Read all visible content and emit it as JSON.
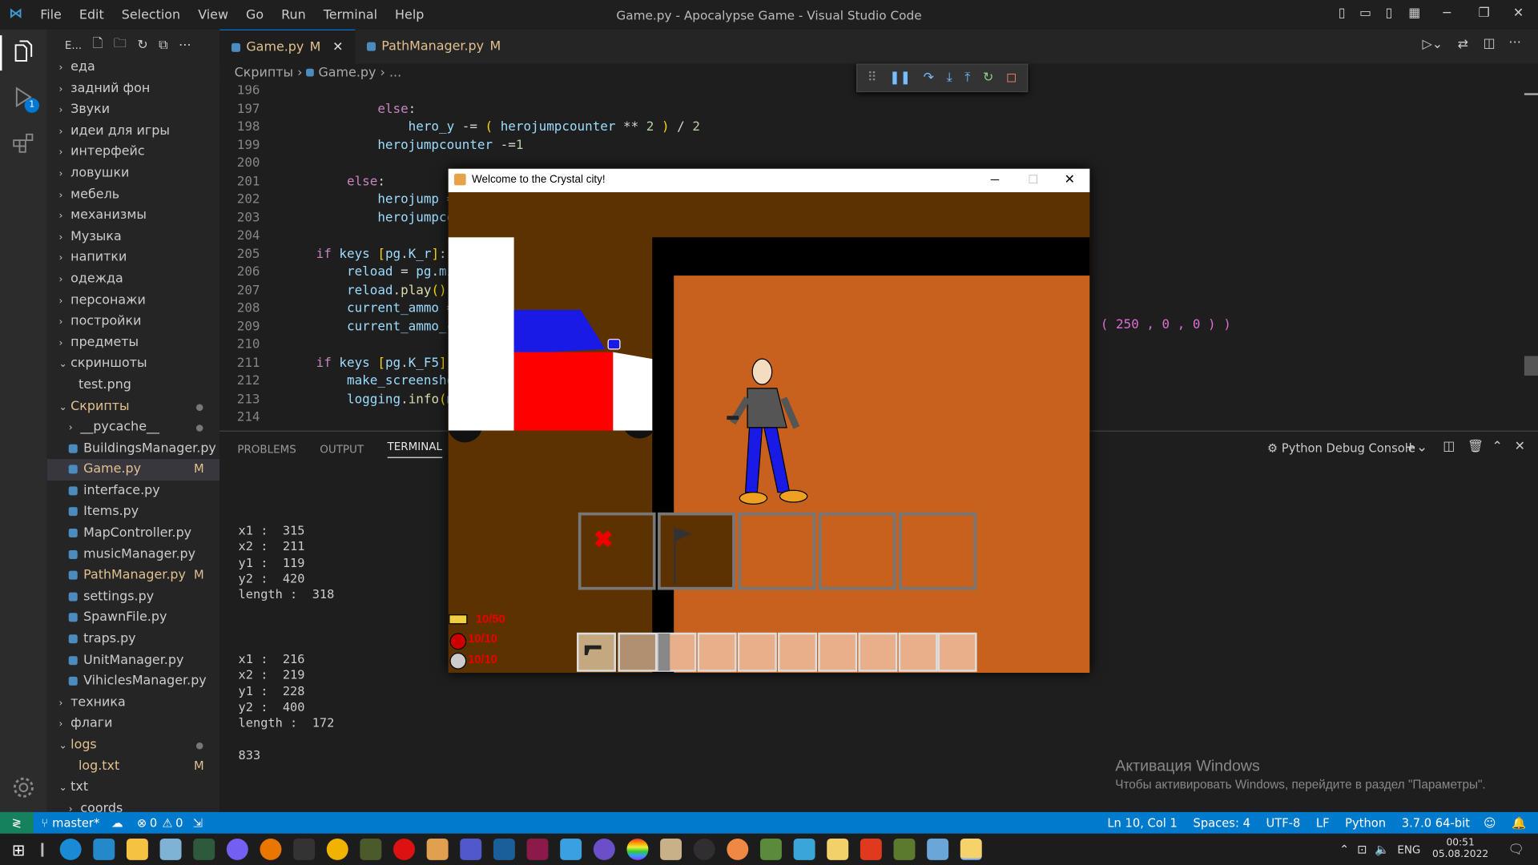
{
  "window": {
    "menu": [
      "File",
      "Edit",
      "Selection",
      "View",
      "Go",
      "Run",
      "Terminal",
      "Help"
    ],
    "title": "Game.py - Apocalypse Game - Visual Studio Code"
  },
  "activity": {
    "debug_badge": "1"
  },
  "sidebar": {
    "header_label": "E...",
    "items": [
      {
        "label": "еда",
        "type": "folder",
        "open": false,
        "indent": 0
      },
      {
        "label": "задний фон",
        "type": "folder",
        "open": false,
        "indent": 0
      },
      {
        "label": "Звуки",
        "type": "folder",
        "open": false,
        "indent": 0
      },
      {
        "label": "идеи для игры",
        "type": "folder",
        "open": false,
        "indent": 0
      },
      {
        "label": "интерфейс",
        "type": "folder",
        "open": false,
        "indent": 0
      },
      {
        "label": "ловушки",
        "type": "folder",
        "open": false,
        "indent": 0
      },
      {
        "label": "мебель",
        "type": "folder",
        "open": false,
        "indent": 0
      },
      {
        "label": "механизмы",
        "type": "folder",
        "open": false,
        "indent": 0
      },
      {
        "label": "Музыка",
        "type": "folder",
        "open": false,
        "indent": 0
      },
      {
        "label": "напитки",
        "type": "folder",
        "open": false,
        "indent": 0
      },
      {
        "label": "одежда",
        "type": "folder",
        "open": false,
        "indent": 0
      },
      {
        "label": "персонажи",
        "type": "folder",
        "open": false,
        "indent": 0
      },
      {
        "label": "постройки",
        "type": "folder",
        "open": false,
        "indent": 0
      },
      {
        "label": "предметы",
        "type": "folder",
        "open": false,
        "indent": 0
      },
      {
        "label": "скриншоты",
        "type": "folder",
        "open": true,
        "indent": 0
      },
      {
        "label": "test.png",
        "type": "file",
        "indent": 1
      },
      {
        "label": "Скрипты",
        "type": "folder",
        "open": true,
        "indent": 0,
        "dot": true,
        "color": "#e2c08d"
      },
      {
        "label": "__pycache__",
        "type": "folder",
        "open": false,
        "indent": 1,
        "dot": true
      },
      {
        "label": "BuildingsManager.py",
        "type": "py",
        "indent": 1
      },
      {
        "label": "Game.py",
        "type": "py",
        "indent": 1,
        "badge": "M",
        "selected": true,
        "color": "#e2c08d"
      },
      {
        "label": "interface.py",
        "type": "py",
        "indent": 1
      },
      {
        "label": "Items.py",
        "type": "py",
        "indent": 1
      },
      {
        "label": "MapController.py",
        "type": "py",
        "indent": 1
      },
      {
        "label": "musicManager.py",
        "type": "py",
        "indent": 1
      },
      {
        "label": "PathManager.py",
        "type": "py",
        "indent": 1,
        "badge": "M",
        "color": "#e2c08d"
      },
      {
        "label": "settings.py",
        "type": "py",
        "indent": 1
      },
      {
        "label": "SpawnFile.py",
        "type": "py",
        "indent": 1
      },
      {
        "label": "traps.py",
        "type": "py",
        "indent": 1
      },
      {
        "label": "UnitManager.py",
        "type": "py",
        "indent": 1
      },
      {
        "label": "VihiclesManager.py",
        "type": "py",
        "indent": 1
      },
      {
        "label": "техника",
        "type": "folder",
        "open": false,
        "indent": 0
      },
      {
        "label": "флаги",
        "type": "folder",
        "open": false,
        "indent": 0
      },
      {
        "label": "logs",
        "type": "folder",
        "open": true,
        "indent": 0,
        "dot": true,
        "color": "#e2c08d"
      },
      {
        "label": "log.txt",
        "type": "file",
        "indent": 1,
        "badge": "M",
        "color": "#e2c08d"
      },
      {
        "label": "txt",
        "type": "folder",
        "open": true,
        "indent": 0
      },
      {
        "label": "coords",
        "type": "folder",
        "open": false,
        "indent": 1
      }
    ]
  },
  "tabs": [
    {
      "label": "Game.py",
      "badge": "M",
      "active": true
    },
    {
      "label": "PathManager.py",
      "badge": "M",
      "active": false
    }
  ],
  "breadcrumb": {
    "folder": "Скрипты",
    "file": "Game.py",
    "rest": "..."
  },
  "editor": {
    "lines": [
      {
        "n": "196",
        "code": ""
      },
      {
        "n": "197",
        "code": "            else:"
      },
      {
        "n": "198",
        "code": "                hero_y -= ( herojumpcounter ** 2 ) / 2"
      },
      {
        "n": "199",
        "code": "            herojumpcounter -=1"
      },
      {
        "n": "200",
        "code": ""
      },
      {
        "n": "201",
        "code": "        else:"
      },
      {
        "n": "202",
        "code": "            herojump ="
      },
      {
        "n": "203",
        "code": "            herojumpco"
      },
      {
        "n": "204",
        "code": ""
      },
      {
        "n": "205",
        "code": "    if keys [pg.K_r]:"
      },
      {
        "n": "206",
        "code": "        reload = pg.mi"
      },
      {
        "n": "207",
        "code": "        reload.play()"
      },
      {
        "n": "208",
        "code": "        current_ammo ="
      },
      {
        "n": "209",
        "code": "        current_ammo_c"
      },
      {
        "n": "210",
        "code": ""
      },
      {
        "n": "211",
        "code": "    if keys [pg.K_F5]"
      },
      {
        "n": "212",
        "code": "        make_screensho"
      },
      {
        "n": "213",
        "code": "        logging.info(m"
      },
      {
        "n": "214",
        "code": ""
      }
    ],
    "overflow_fragment": "( 250 , 0 , 0 ) )"
  },
  "panel": {
    "tabs": [
      "PROBLEMS",
      "OUTPUT",
      "TERMINAL"
    ],
    "active_tab": "TERMINAL",
    "console_name": "Python Debug Console",
    "terminal_block1": "x1 :  315\nx2 :  211\ny1 :  119\ny2 :  420\nlength :  318",
    "terminal_block2": "x1 :  216\nx2 :  219\ny1 :  228\ny2 :  400\nlength :  172",
    "terminal_last": "833",
    "watermark_title": "Активация Windows",
    "watermark_text": "Чтобы активировать Windows, перейдите в раздел \"Параметры\"."
  },
  "status": {
    "branch": "master*",
    "errors": "0",
    "warnings": "0",
    "position": "Ln 10, Col 1",
    "spaces": "Spaces: 4",
    "encoding": "UTF-8",
    "eol": "LF",
    "language": "Python",
    "interpreter": "3.7.0 64-bit"
  },
  "game": {
    "title": "Welcome to the Crystal city!",
    "ammo": "10/50",
    "health": "10/10",
    "armor": "10/10"
  },
  "taskbar": {
    "lang": "ENG",
    "time": "00:51",
    "date": "05.08.2022"
  }
}
